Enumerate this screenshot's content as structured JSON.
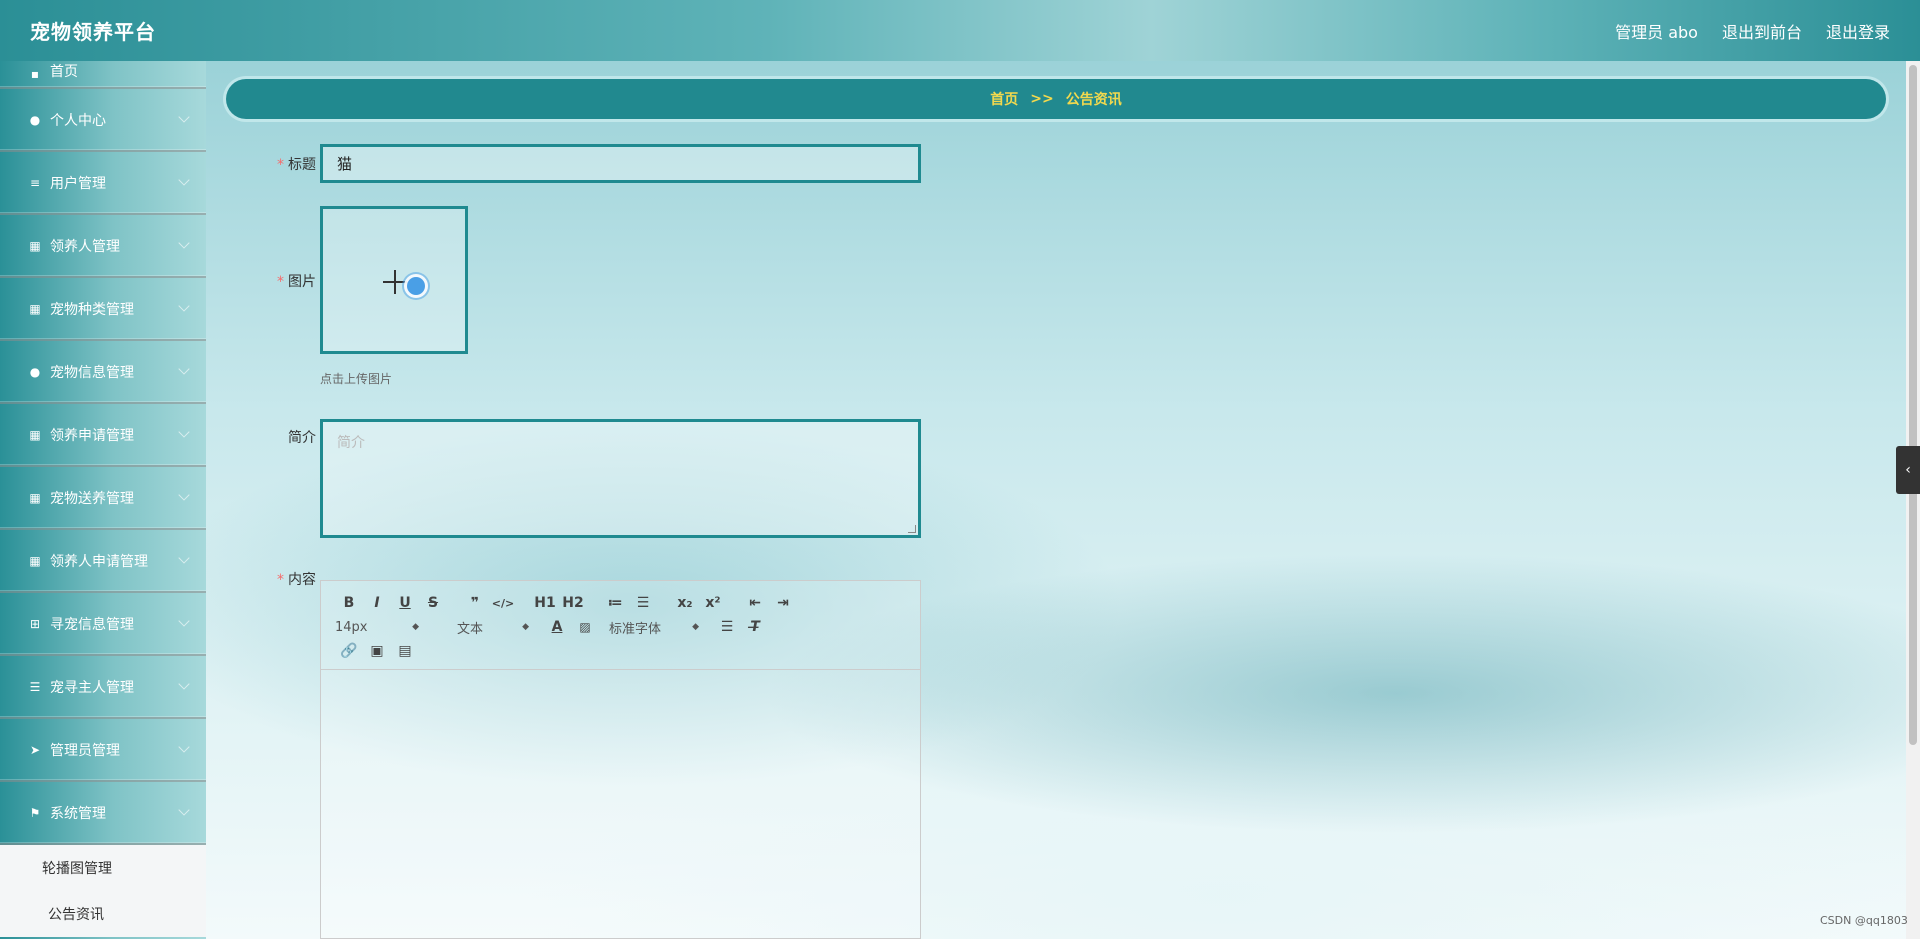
{
  "header": {
    "brand": "宠物领养平台",
    "user_label": "管理员 abo",
    "exit_front": "退出到前台",
    "logout": "退出登录"
  },
  "sidebar": {
    "partial_top": "首页",
    "items": [
      {
        "label": "个人中心",
        "icon": "user-icon"
      },
      {
        "label": "用户管理",
        "icon": "sliders-icon"
      },
      {
        "label": "领养人管理",
        "icon": "grid-icon"
      },
      {
        "label": "宠物种类管理",
        "icon": "grid-icon"
      },
      {
        "label": "宠物信息管理",
        "icon": "user-icon"
      },
      {
        "label": "领养申请管理",
        "icon": "grid-icon"
      },
      {
        "label": "宠物送养管理",
        "icon": "grid-icon"
      },
      {
        "label": "领养人申请管理",
        "icon": "grid-icon"
      },
      {
        "label": "寻宠信息管理",
        "icon": "grid-small-icon"
      },
      {
        "label": "宠寻主人管理",
        "icon": "list-icon"
      },
      {
        "label": "管理员管理",
        "icon": "send-icon"
      },
      {
        "label": "系统管理",
        "icon": "flag-icon"
      }
    ],
    "submenu": [
      "轮播图管理",
      "公告资讯"
    ]
  },
  "breadcrumb": {
    "home": "首页",
    "sep": ">>",
    "current": "公告资讯"
  },
  "form": {
    "title_label": "标题",
    "title_value": "猫",
    "image_label": "图片",
    "upload_hint": "点击上传图片",
    "intro_label": "简介",
    "intro_placeholder": "简介",
    "content_label": "内容"
  },
  "editor": {
    "font_size": "14px",
    "header_select": "文本",
    "font_family": "标准字体",
    "buttons_row1": [
      "B",
      "I",
      "U",
      "S",
      "❞",
      "</>",
      "H1",
      "H2",
      "≔",
      "☰",
      "x₂",
      "x²",
      "⇤",
      "⇥"
    ]
  },
  "watermark": "CSDN @qq1803"
}
